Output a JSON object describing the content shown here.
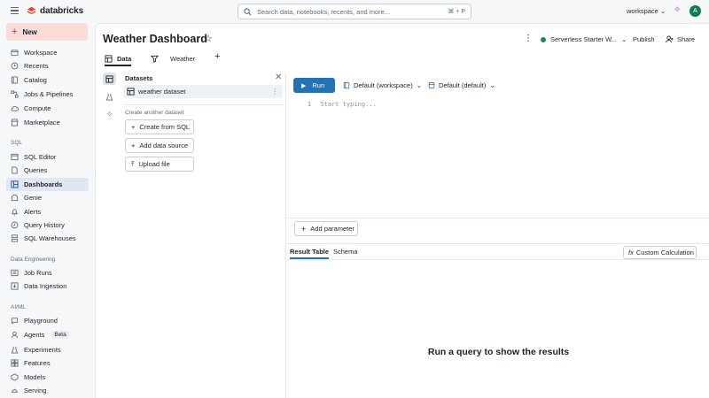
{
  "topbar": {
    "brand": "databricks",
    "search_placeholder": "Search data, notebooks, recents, and more...",
    "search_shortcut": "⌘ + P",
    "workspace_label": "workspace",
    "avatar_initial": "A"
  },
  "sidebar": {
    "new_label": "New",
    "items": [
      {
        "label": "Workspace",
        "icon": "folder-icon"
      },
      {
        "label": "Recents",
        "icon": "clock-icon"
      },
      {
        "label": "Catalog",
        "icon": "catalog-icon"
      },
      {
        "label": "Jobs & Pipelines",
        "icon": "workflow-icon"
      },
      {
        "label": "Compute",
        "icon": "cloud-icon"
      },
      {
        "label": "Marketplace",
        "icon": "store-icon"
      }
    ],
    "sql_section": "SQL",
    "sql_items": [
      {
        "label": "SQL Editor",
        "icon": "editor-icon"
      },
      {
        "label": "Queries",
        "icon": "queries-icon"
      },
      {
        "label": "Dashboards",
        "icon": "dashboard-icon",
        "active": true
      },
      {
        "label": "Genie",
        "icon": "genie-icon"
      },
      {
        "label": "Alerts",
        "icon": "bell-icon"
      },
      {
        "label": "Query History",
        "icon": "history-icon"
      },
      {
        "label": "SQL Warehouses",
        "icon": "warehouse-icon"
      }
    ],
    "de_section": "Data Engineering",
    "de_items": [
      {
        "label": "Job Runs",
        "icon": "job-runs-icon"
      },
      {
        "label": "Data Ingestion",
        "icon": "ingestion-icon"
      }
    ],
    "ml_section": "AI/ML",
    "ml_items": [
      {
        "label": "Playground",
        "icon": "playground-icon"
      },
      {
        "label": "Agents",
        "icon": "agents-icon",
        "badge": "Beta"
      },
      {
        "label": "Experiments",
        "icon": "experiments-icon"
      },
      {
        "label": "Features",
        "icon": "features-icon"
      },
      {
        "label": "Models",
        "icon": "models-icon"
      },
      {
        "label": "Serving",
        "icon": "serving-icon"
      }
    ]
  },
  "header": {
    "title": "Weather Dashboard",
    "warehouse": "Serverless Starter W...",
    "publish": "Publish",
    "share": "Share"
  },
  "tabs": [
    {
      "label": "Data",
      "active": true
    },
    {
      "label": "Weather",
      "active": false
    }
  ],
  "datasets": {
    "title": "Datasets",
    "items": [
      "weather dataset"
    ],
    "create_another": "Create another dataset",
    "create_from_sql": "Create from SQL",
    "add_data_source": "Add data source",
    "upload_file": "Upload file"
  },
  "editor": {
    "run_label": "Run",
    "catalog_dropdown": "Default (workspace)",
    "schema_dropdown": "Default (default)",
    "line_number": "1",
    "placeholder": "Start typing...",
    "add_parameter": "Add parameter"
  },
  "results": {
    "tab_result": "Result Table",
    "tab_schema": "Schema",
    "custom_calc": "Custom Calculation",
    "custom_calc_icon": "fx",
    "empty_message": "Run a query to show the results"
  },
  "colors": {
    "accent": "#2272b4",
    "brand": "#ff3621",
    "active_nav": "#dfe7f3",
    "status_green": "#1e8a4c"
  }
}
